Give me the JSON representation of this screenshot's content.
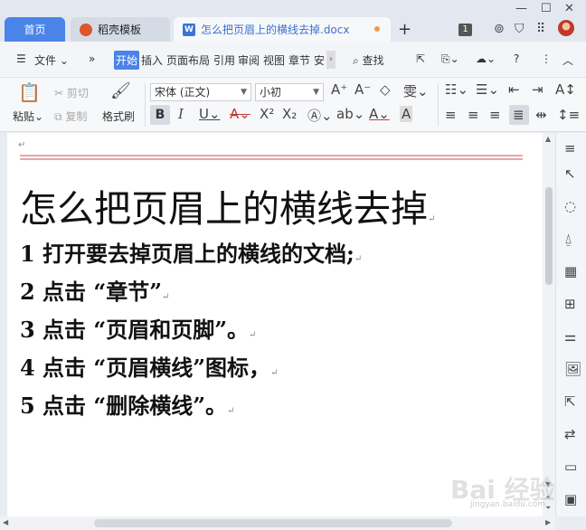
{
  "tabs": {
    "home": "首页",
    "daoke": "稻壳模板",
    "document": "怎么把页眉上的横线去掉.docx"
  },
  "titlebar": {
    "badge": "1"
  },
  "menu": {
    "file": "文件",
    "items": [
      "开始",
      "插入",
      "页面布局",
      "引用",
      "审阅",
      "视图",
      "章节",
      "安"
    ],
    "search": "查找"
  },
  "ribbon": {
    "paste": "粘贴",
    "cut": "剪切",
    "copy": "复制",
    "format_painter": "格式刷",
    "font_name": "宋体 (正文)",
    "font_size": "小初",
    "bold": "B",
    "italic": "I",
    "underline": "U",
    "strike": "A",
    "superscript": "X²",
    "subscript": "X₂",
    "font_color": "A"
  },
  "document": {
    "title": "怎么把页眉上的横线去掉",
    "lines": [
      "1 打开要去掉页眉上的横线的文档;",
      "2 点击 “章节”",
      "3 点击 “页眉和页脚”。",
      "4 点击 “页眉横线”图标，",
      "5 点击 “删除横线”。"
    ]
  },
  "colors": {
    "accent": "#4a84e8",
    "header_line": "#e8a7a7"
  },
  "icons": {
    "right_panel": [
      "select-icon",
      "shapes-icon",
      "style-icon",
      "table-icon",
      "apps-icon",
      "settings-icon",
      "image-icon",
      "share-icon",
      "translate-icon",
      "archive-icon",
      "gallery-icon"
    ]
  },
  "watermark": {
    "main": "Bai 经验",
    "sub": "jingyan.baidu.com"
  }
}
